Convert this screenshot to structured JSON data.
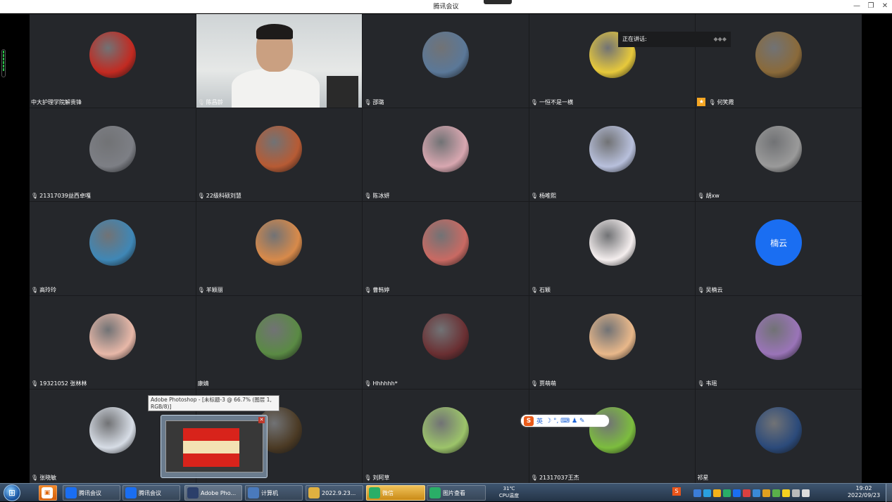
{
  "window": {
    "title": "腾讯会议",
    "minimize": "—",
    "maximize": "❐",
    "close": "✕"
  },
  "speaking": {
    "label": "正在讲话:",
    "dots": "◆◆◆"
  },
  "participants": [
    {
      "name": "中大护理学院解贵锋",
      "mic": false,
      "avatar_color": "#c22a21"
    },
    {
      "name": "陈昌龄",
      "mic": true,
      "video": true
    },
    {
      "name": "邵璐",
      "mic": true,
      "avatar_color": "#5b7898"
    },
    {
      "name": "一恒不是一横",
      "mic": true,
      "avatar_color": "#e7c93b"
    },
    {
      "name": "何笑霞",
      "mic": true,
      "badge": true,
      "avatar_color": "#8a6a3a"
    },
    {
      "name": "21317039益西卓嘎",
      "mic": true,
      "avatar_color": "#7d7f85"
    },
    {
      "name": "22级科硕刘慧",
      "mic": true,
      "avatar_color": "#b75b34"
    },
    {
      "name": "陈冰妍",
      "mic": true,
      "avatar_color": "#d8a7b0"
    },
    {
      "name": "杨唯熙",
      "mic": true,
      "avatar_color": "#b8c0dc"
    },
    {
      "name": "胡xw",
      "mic": true,
      "avatar_color": "#9a9a9a"
    },
    {
      "name": "高玲玲",
      "mic": true,
      "avatar_color": "#3f87b6"
    },
    {
      "name": "羊颖丽",
      "mic": true,
      "avatar_color": "#d88a4a"
    },
    {
      "name": "曹韩婷",
      "mic": true,
      "avatar_color": "#c96a63"
    },
    {
      "name": "石颖",
      "mic": true,
      "avatar_color": "#f4eeee"
    },
    {
      "name": "吴楠云",
      "mic": true,
      "avatar_color": "#1a6ef2",
      "avatar_text": "楠云"
    },
    {
      "name": "19321052 张林林",
      "mic": true,
      "avatar_color": "#e8b8a8"
    },
    {
      "name": "康婧",
      "mic": false,
      "avatar_color": "#5a8a44"
    },
    {
      "name": "Hhhhhh*",
      "mic": true,
      "avatar_color": "#6a2f32"
    },
    {
      "name": "贾萌萌",
      "mic": true,
      "avatar_color": "#e9b88a"
    },
    {
      "name": "韦瑶",
      "mic": true,
      "avatar_color": "#9a74b8"
    },
    {
      "name": "张晓敏",
      "mic": true,
      "avatar_color": "#d7dde6"
    },
    {
      "name": "",
      "mic": false,
      "avatar_color": "#4b3a24"
    },
    {
      "name": "刘阿草",
      "mic": true,
      "avatar_color": "#9cc46a"
    },
    {
      "name": "21317037王杰",
      "mic": true,
      "avatar_color": "#7cbd3e"
    },
    {
      "name": "祁星",
      "mic": false,
      "avatar_color": "#2b4a7a"
    }
  ],
  "tooltip": {
    "text": "Adobe Photoshop - [未标题-3 @ 66.7% (图层 1, RGB/8)]"
  },
  "ime": {
    "lang": "英",
    "logo": "S",
    "icons": "☽ °, ⌨ ♟ ✎"
  },
  "taskbar": {
    "items": [
      {
        "label": "腾讯会议",
        "icon_color": "#1a6ef2"
      },
      {
        "label": "腾讯会议",
        "icon_color": "#1a6ef2"
      },
      {
        "label": "Adobe Pho...",
        "icon_color": "#2b3f6a"
      },
      {
        "label": "计算机",
        "icon_color": "#4a7abc"
      },
      {
        "label": "2022.9.23...",
        "icon_color": "#e0b040"
      },
      {
        "label": "微信",
        "icon_color": "#2aae67"
      },
      {
        "label": "图片查看",
        "icon_color": "#2aae67"
      }
    ],
    "cpu_temp": "31℃",
    "cpu_label": "CPU温度",
    "time": "19:02",
    "date": "2022/09/23"
  }
}
